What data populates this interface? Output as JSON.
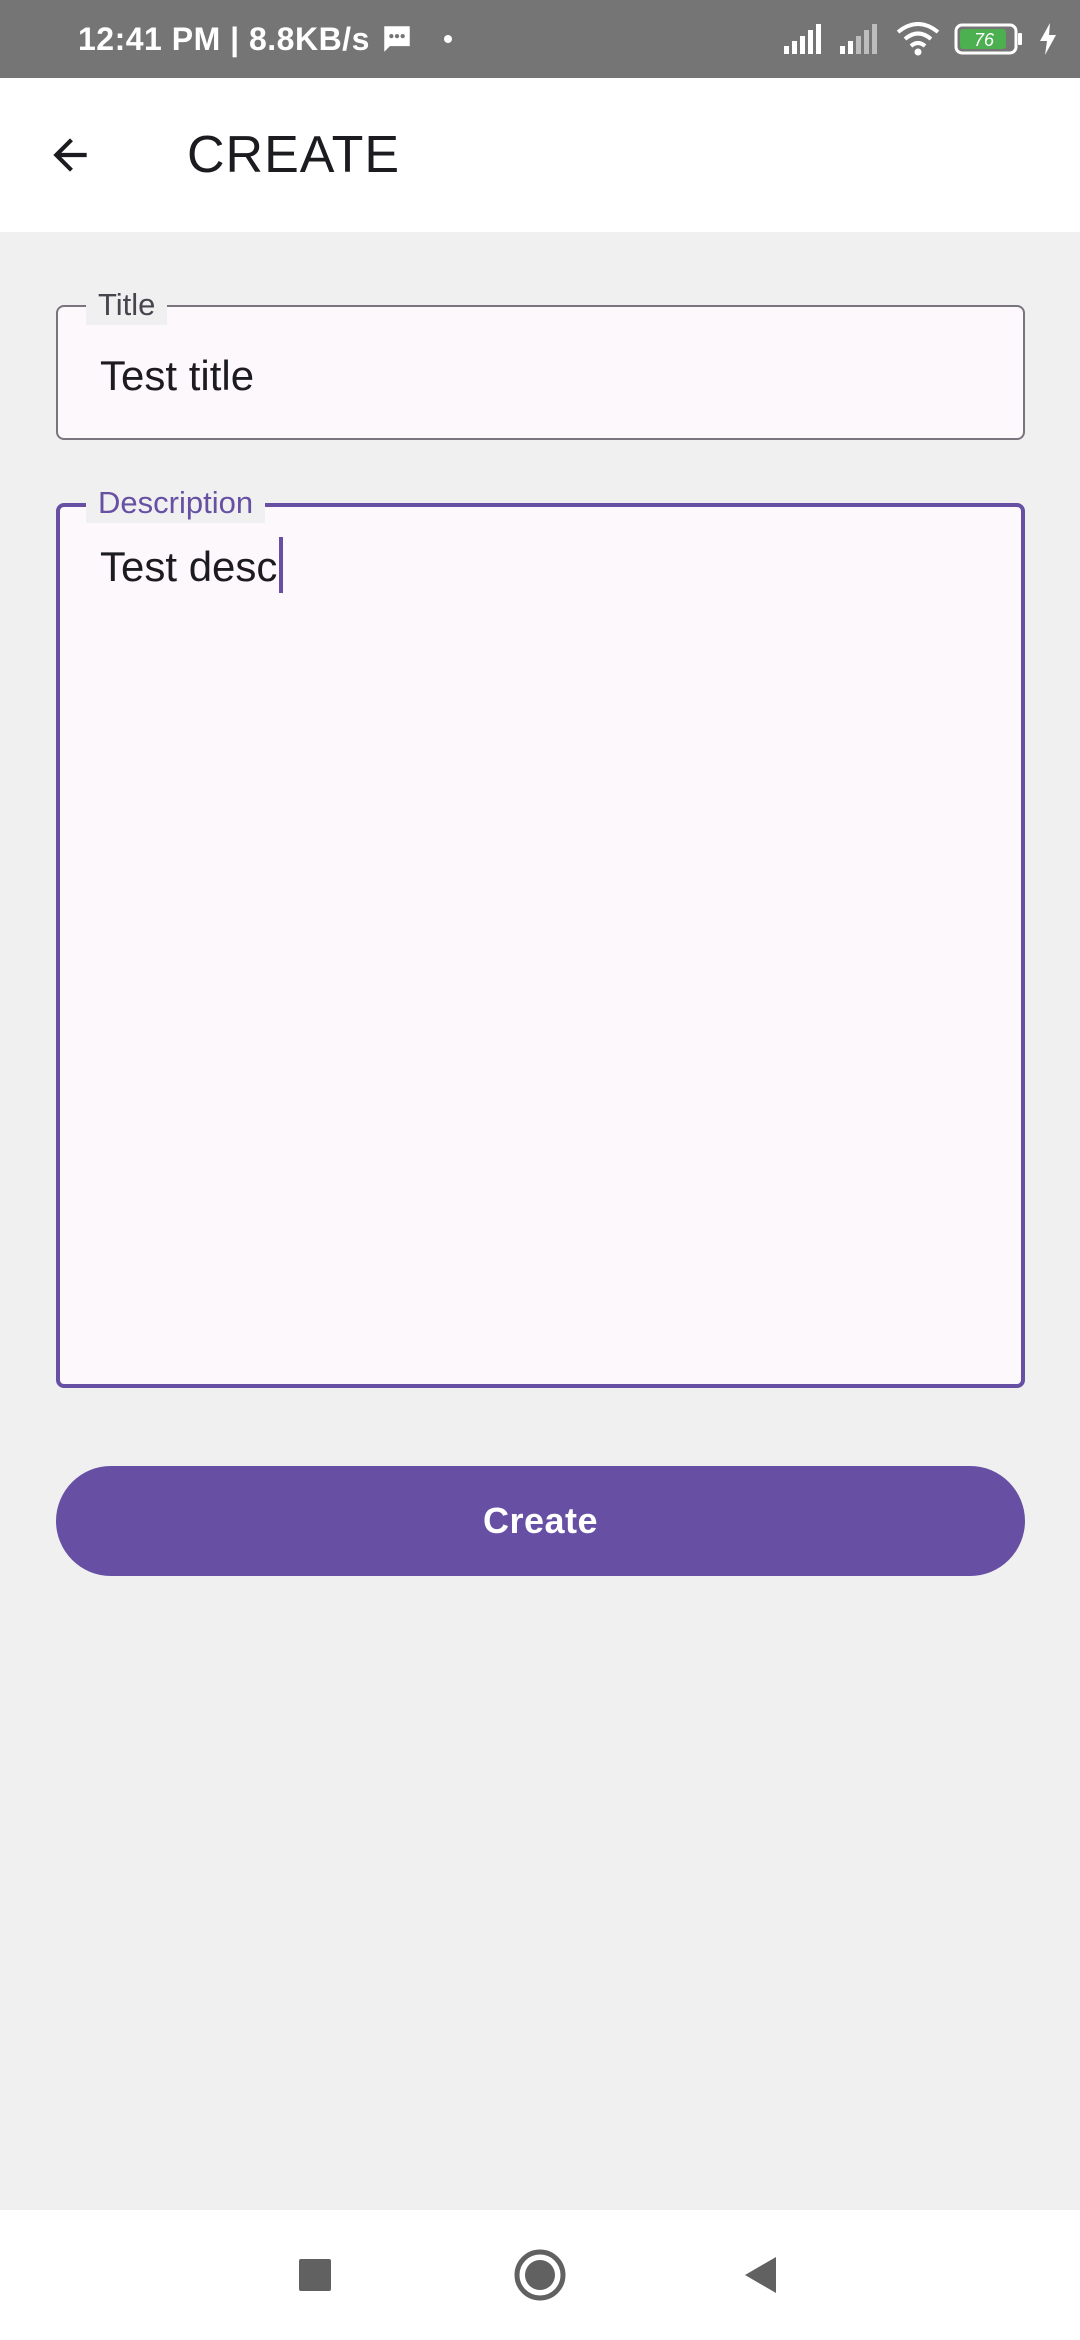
{
  "status_bar": {
    "time_speed": "12:41 PM | 8.8KB/s",
    "battery": "76",
    "colors": {
      "background": "#757575",
      "battery_fill": "#4caf50"
    },
    "icons": [
      "message-icon",
      "signal-icon",
      "signal-icon",
      "wifi-icon",
      "battery-icon",
      "charging-icon"
    ]
  },
  "app_bar": {
    "title": "CREATE",
    "back_icon": "arrow-left-icon"
  },
  "form": {
    "title_field": {
      "label": "Title",
      "value": "Test title"
    },
    "description_field": {
      "label": "Description",
      "value": "Test desc",
      "focused": true
    },
    "submit_label": "Create"
  },
  "nav_bar": {
    "icons": [
      "recents-square-icon",
      "home-circle-icon",
      "back-triangle-icon"
    ]
  },
  "colors": {
    "accent": "#6750a4",
    "background": "#f0f0f0",
    "surface": "#ffffff",
    "field_fill": "#fdf8fc"
  }
}
